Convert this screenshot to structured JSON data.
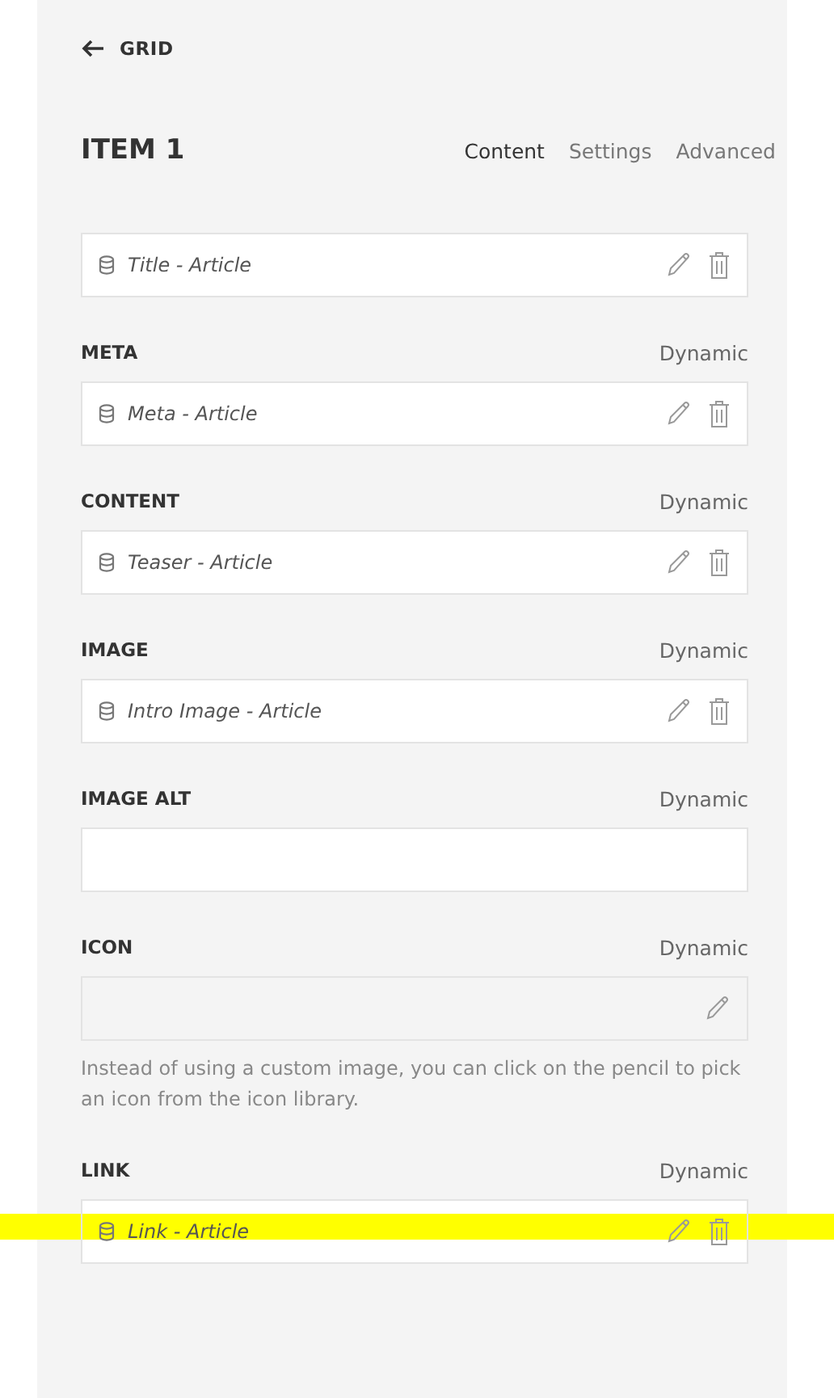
{
  "back_link": {
    "label": "GRID"
  },
  "header": {
    "title": "ITEM 1"
  },
  "tabs": [
    {
      "label": "Content",
      "selected": true
    },
    {
      "label": "Settings",
      "selected": false
    },
    {
      "label": "Advanced",
      "selected": false
    }
  ],
  "fields": [
    {
      "kind": "dynamic",
      "value": "Title - Article",
      "highlighted": false
    },
    {
      "kind": "dynamic",
      "label": "META",
      "source": "Dynamic",
      "value": "Meta - Article",
      "highlighted": false
    },
    {
      "kind": "dynamic",
      "label": "CONTENT",
      "source": "Dynamic",
      "value": "Teaser - Article",
      "highlighted": false
    },
    {
      "kind": "dynamic",
      "label": "IMAGE",
      "source": "Dynamic",
      "value": "Intro Image - Article",
      "highlighted": false
    },
    {
      "kind": "empty",
      "label": "IMAGE ALT",
      "source": "Dynamic",
      "highlighted": false
    },
    {
      "kind": "icon",
      "label": "ICON",
      "source": "Dynamic",
      "help": "Instead of using a custom image, you can click on the pencil to pick an icon from the icon library.",
      "highlighted": false
    },
    {
      "kind": "dynamic",
      "label": "LINK",
      "source": "Dynamic",
      "value": "Link - Article",
      "highlighted": true
    }
  ]
}
